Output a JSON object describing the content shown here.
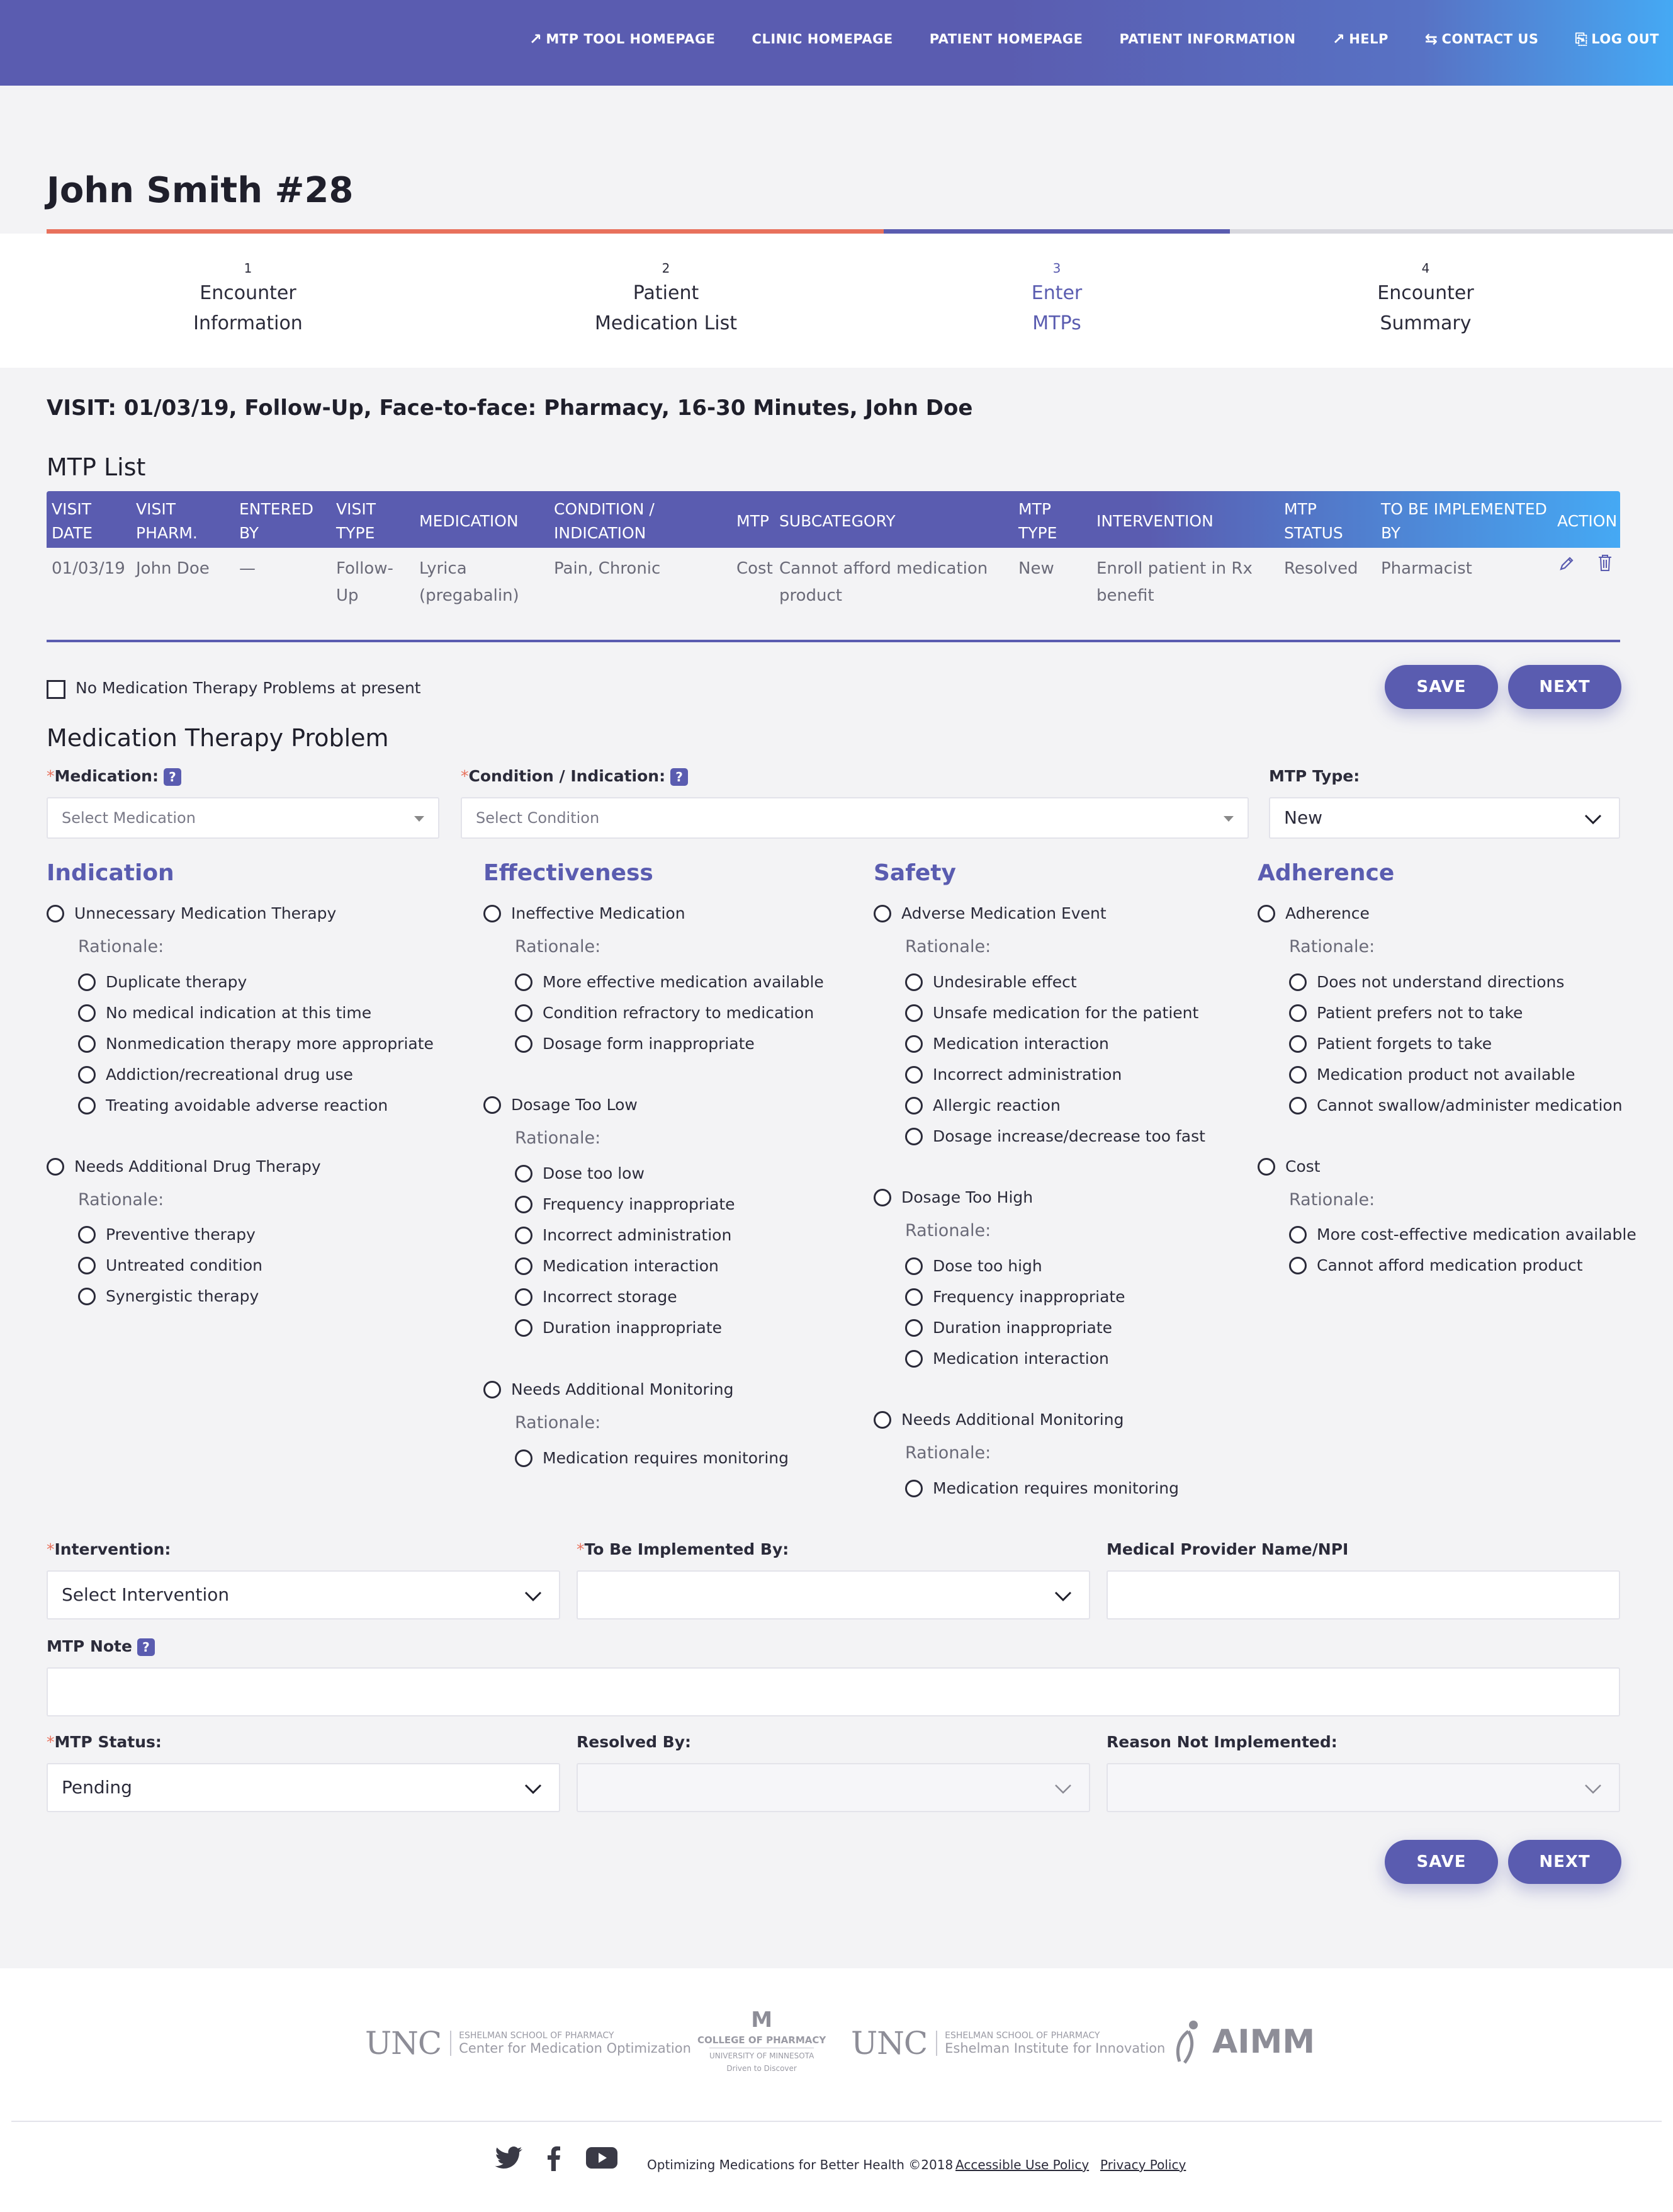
{
  "nav": {
    "items": [
      {
        "label": "MTP TOOL HOMEPAGE",
        "icon": "external-arrow-icon"
      },
      {
        "label": "CLINIC HOMEPAGE",
        "icon": ""
      },
      {
        "label": "PATIENT HOMEPAGE",
        "icon": ""
      },
      {
        "label": "PATIENT INFORMATION",
        "icon": ""
      },
      {
        "label": "HELP",
        "icon": "external-arrow-icon"
      },
      {
        "label": "CONTACT US",
        "icon": "swap-arrows-icon"
      },
      {
        "label": "LOG OUT",
        "icon": "logout-icon"
      }
    ]
  },
  "page": {
    "title": "John Smith #28"
  },
  "steps": [
    {
      "num": "1",
      "line1": "Encounter",
      "line2": "Information"
    },
    {
      "num": "2",
      "line1": "Patient",
      "line2": "Medication List"
    },
    {
      "num": "3",
      "line1": "Enter",
      "line2": "MTPs"
    },
    {
      "num": "4",
      "line1": "Encounter",
      "line2": "Summary"
    }
  ],
  "visit": "VISIT: 01/03/19, Follow-Up, Face-to-face: Pharmacy, 16-30 Minutes, John Doe",
  "mtp_list": {
    "title": "MTP List",
    "headers": [
      [
        "VISIT",
        "DATE"
      ],
      [
        "VISIT",
        "PHARM."
      ],
      [
        "ENTERED",
        "BY"
      ],
      [
        "VISIT",
        "TYPE"
      ],
      [
        "MEDICATION",
        ""
      ],
      [
        "CONDITION /",
        "INDICATION"
      ],
      [
        "MTP",
        ""
      ],
      [
        "SUBCATEGORY",
        ""
      ],
      [
        "MTP",
        "TYPE"
      ],
      [
        "INTERVENTION",
        ""
      ],
      [
        "MTP",
        "STATUS"
      ],
      [
        "TO BE IMPLEMENTED",
        "BY"
      ],
      [
        "ACTION",
        ""
      ]
    ],
    "row": [
      [
        "01/03/19",
        ""
      ],
      [
        "John Doe",
        ""
      ],
      [
        "—",
        ""
      ],
      [
        "Follow-",
        "Up"
      ],
      [
        "Lyrica",
        "(pregabalin)"
      ],
      [
        "Pain, Chronic",
        ""
      ],
      [
        "Cost",
        ""
      ],
      [
        "Cannot afford medication",
        "product"
      ],
      [
        "New",
        ""
      ],
      [
        "Enroll patient in Rx",
        "benefit"
      ],
      [
        "Resolved",
        ""
      ],
      [
        "Pharmacist",
        ""
      ]
    ]
  },
  "no_mtp_label": "No Medication Therapy Problems at present",
  "buttons": {
    "save": "SAVE",
    "next": "NEXT"
  },
  "form": {
    "title": "Medication Therapy Problem",
    "required_mark": "*",
    "help_mark": "?",
    "medication_label": "Medication:",
    "medication_placeholder": "Select Medication",
    "condition_label": "Condition / Indication:",
    "condition_placeholder": "Select Condition",
    "mtp_type_label": "MTP Type:",
    "mtp_type_value": "New",
    "intervention_label": "Intervention:",
    "intervention_value": "Select Intervention",
    "implemented_label": "To Be Implemented By:",
    "implemented_value": "",
    "provider_label": "Medical Provider Name/NPI",
    "provider_value": "",
    "note_label": "MTP Note",
    "note_value": "",
    "status_label": "MTP Status:",
    "status_value": "Pending",
    "resolved_label": "Resolved By:",
    "resolved_value": "",
    "reason_label": "Reason Not Implemented:",
    "reason_value": ""
  },
  "rationale_label": "Rationale:",
  "categories": {
    "indication": {
      "title": "Indication",
      "groups": [
        {
          "label": "Unnecessary Medication Therapy",
          "options": [
            "Duplicate therapy",
            "No medical indication at this time",
            "Nonmedication therapy more appropriate",
            "Addiction/recreational drug use",
            "Treating avoidable adverse reaction"
          ]
        },
        {
          "label": "Needs Additional Drug Therapy",
          "options": [
            "Preventive therapy",
            "Untreated condition",
            "Synergistic therapy"
          ]
        }
      ]
    },
    "effectiveness": {
      "title": "Effectiveness",
      "groups": [
        {
          "label": "Ineffective Medication",
          "options": [
            "More effective medication available",
            "Condition refractory to medication",
            "Dosage form inappropriate"
          ]
        },
        {
          "label": "Dosage Too Low",
          "options": [
            "Dose too low",
            "Frequency inappropriate",
            "Incorrect administration",
            "Medication interaction",
            "Incorrect storage",
            "Duration inappropriate"
          ]
        },
        {
          "label": "Needs Additional Monitoring",
          "options": [
            "Medication requires monitoring"
          ]
        }
      ]
    },
    "safety": {
      "title": "Safety",
      "groups": [
        {
          "label": "Adverse Medication Event",
          "options": [
            "Undesirable effect",
            "Unsafe medication for the patient",
            "Medication interaction",
            "Incorrect administration",
            "Allergic reaction",
            "Dosage increase/decrease too fast"
          ]
        },
        {
          "label": "Dosage Too High",
          "options": [
            "Dose too high",
            "Frequency inappropriate",
            "Duration inappropriate",
            "Medication interaction"
          ]
        },
        {
          "label": "Needs Additional Monitoring",
          "options": [
            "Medication requires monitoring"
          ]
        }
      ]
    },
    "adherence": {
      "title": "Adherence",
      "groups": [
        {
          "label": "Adherence",
          "options": [
            "Does not understand directions",
            "Patient prefers not to take",
            "Patient forgets to take",
            "Medication product not available",
            "Cannot swallow/administer medication"
          ]
        },
        {
          "label": "Cost",
          "options": [
            "More cost-effective medication available",
            "Cannot afford medication product"
          ]
        }
      ]
    }
  },
  "footer": {
    "logos": {
      "unc1_big": "UNC",
      "unc1_small": "ESHELMAN SCHOOL OF PHARMACY",
      "unc1_mid": "Center for Medication Optimization",
      "umn_line1": "COLLEGE OF PHARMACY",
      "umn_line2": "UNIVERSITY OF MINNESOTA",
      "umn_line3": "Driven to Discover",
      "unc2_big": "UNC",
      "unc2_small": "ESHELMAN SCHOOL OF PHARMACY",
      "unc2_mid": "Eshelman Institute for Innovation",
      "aimm": "AIMM"
    },
    "tagline": "Optimizing Medications for Better Health ©2018",
    "accessible": "Accessible Use Policy",
    "privacy": "Privacy Policy"
  }
}
